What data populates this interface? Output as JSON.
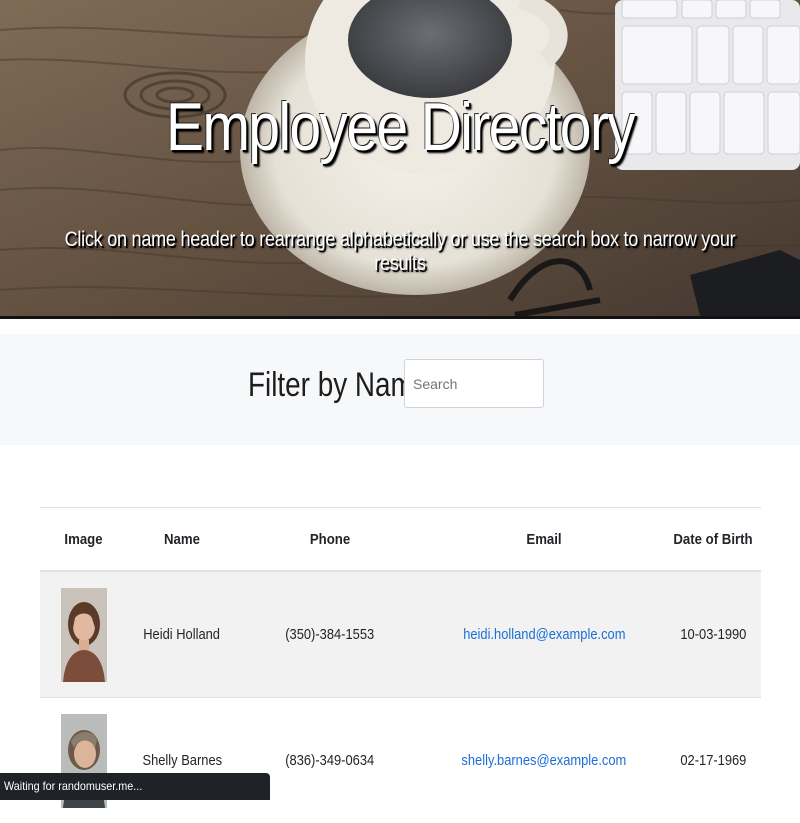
{
  "hero": {
    "title": "Employee Directory",
    "subtitle": "Click on name header to rearrange alphabetically or use the search box to narrow your results"
  },
  "filter": {
    "label": "Filter by Name:",
    "placeholder": "Search",
    "value": ""
  },
  "table": {
    "headers": {
      "image": "Image",
      "name": "Name",
      "phone": "Phone",
      "email": "Email",
      "dob": "Date of Birth"
    },
    "rows": [
      {
        "name": "Heidi Holland",
        "phone": "(350)-384-1553",
        "email": "heidi.holland@example.com",
        "dob": "10-03-1990"
      },
      {
        "name": "Shelly Barnes",
        "phone": "(836)-349-0634",
        "email": "shelly.barnes@example.com",
        "dob": "02-17-1969"
      }
    ]
  },
  "status": {
    "text": "Waiting for randomuser.me..."
  },
  "colors": {
    "link": "#1a6ed8",
    "stripe": "#f2f2f2",
    "filter_bg": "#f7f8fa",
    "status_bg": "#1f2226"
  }
}
